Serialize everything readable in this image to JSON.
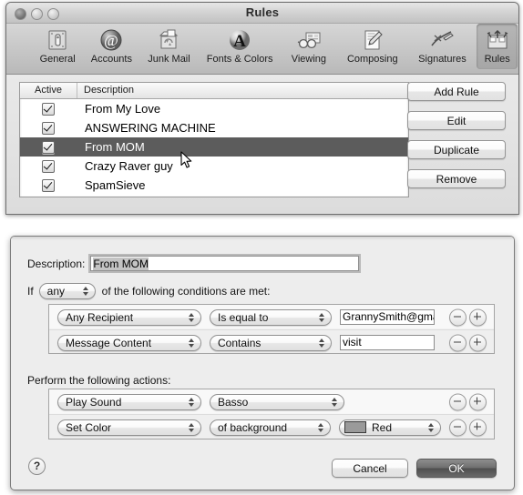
{
  "window": {
    "title": "Rules",
    "controls": [
      {
        "name": "close-button",
        "label": "close"
      },
      {
        "name": "minimize-button",
        "label": "minimize"
      },
      {
        "name": "zoom-button",
        "label": "zoom"
      }
    ]
  },
  "toolbar": {
    "items": [
      {
        "label": "General",
        "icon": "general-icon",
        "selected": false
      },
      {
        "label": "Accounts",
        "icon": "accounts-at-icon",
        "selected": false
      },
      {
        "label": "Junk Mail",
        "icon": "junk-mail-icon",
        "selected": false
      },
      {
        "label": "Fonts & Colors",
        "icon": "fonts-colors-icon",
        "selected": false
      },
      {
        "label": "Viewing",
        "icon": "viewing-icon",
        "selected": false
      },
      {
        "label": "Composing",
        "icon": "composing-icon",
        "selected": false
      },
      {
        "label": "Signatures",
        "icon": "signatures-icon",
        "selected": false
      },
      {
        "label": "Rules",
        "icon": "rules-icon",
        "selected": true
      }
    ]
  },
  "rules_list": {
    "columns": {
      "active": "Active",
      "description": "Description"
    },
    "rows": [
      {
        "active": true,
        "description": "From My Love",
        "selected": false
      },
      {
        "active": true,
        "description": "ANSWERING MACHINE",
        "selected": false
      },
      {
        "active": true,
        "description": "From MOM",
        "selected": true
      },
      {
        "active": true,
        "description": "Crazy Raver guy",
        "selected": false
      },
      {
        "active": true,
        "description": "SpamSieve",
        "selected": false
      }
    ]
  },
  "side_buttons": {
    "add_rule": "Add Rule",
    "edit": "Edit",
    "duplicate": "Duplicate",
    "remove": "Remove"
  },
  "edit_dialog": {
    "description_label": "Description:",
    "description_value": "From MOM",
    "if_prefix": "If",
    "if_match": "any",
    "if_suffix": "of the following conditions are met:",
    "actions_title": "Perform the following actions:",
    "conditions": [
      {
        "field": "Any Recipient",
        "operator": "Is equal to",
        "value": "GrannySmith@gma"
      },
      {
        "field": "Message Content",
        "operator": "Contains",
        "value": "visit"
      }
    ],
    "actions": [
      {
        "action": "Play Sound",
        "param": "Basso",
        "color": null,
        "color_hex": null
      },
      {
        "action": "Set Color",
        "param": "of background",
        "color": "Red",
        "color_hex": "#9a9a9a"
      }
    ],
    "help_label": "?",
    "cancel_label": "Cancel",
    "ok_label": "OK",
    "minus_label": "−",
    "plus_label": "+"
  }
}
